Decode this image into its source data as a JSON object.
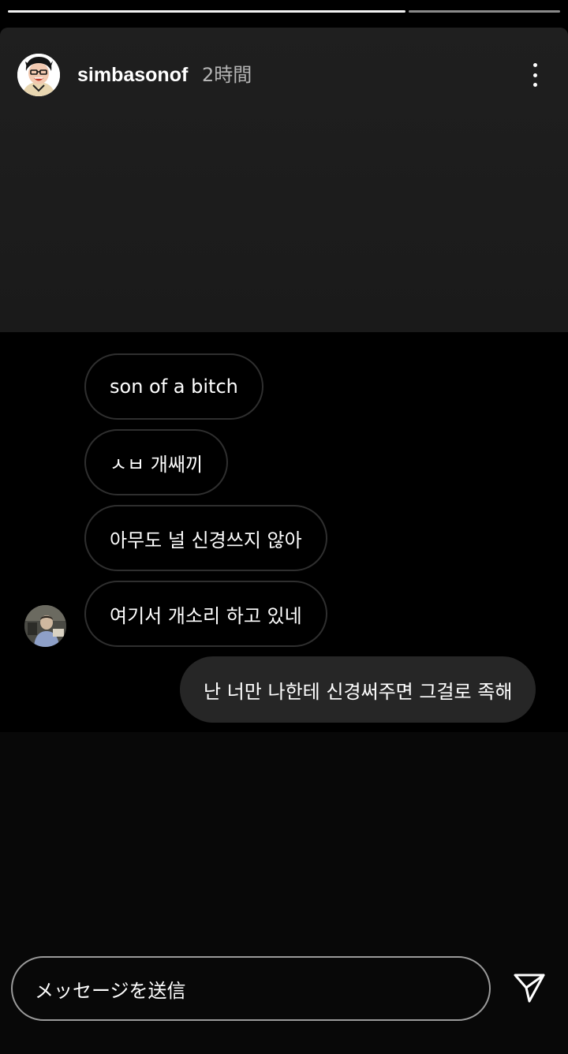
{
  "story": {
    "username": "simbasonof",
    "time_ago": "2時間",
    "progress_segments": 2,
    "progress_viewed_fraction": 0.72
  },
  "messages": [
    {
      "text": "son of a bitch",
      "direction": "incoming"
    },
    {
      "text": "ㅅㅂ 개쌔끼",
      "direction": "incoming"
    },
    {
      "text": "아무도 널 신경쓰지 않아",
      "direction": "incoming"
    },
    {
      "text": "여기서 개소리 하고 있네",
      "direction": "incoming"
    },
    {
      "text": "난 너만 나한테 신경써주면 그걸로 족해",
      "direction": "outgoing"
    }
  ],
  "composer": {
    "placeholder": "メッセージを送信"
  },
  "icons": {
    "more": "more-vertical-icon",
    "send": "send-icon"
  },
  "colors": {
    "background": "#000000",
    "incoming_border": "#2f2f2f",
    "outgoing_bubble": "#262626",
    "timestamp": "#b5b5b5"
  }
}
